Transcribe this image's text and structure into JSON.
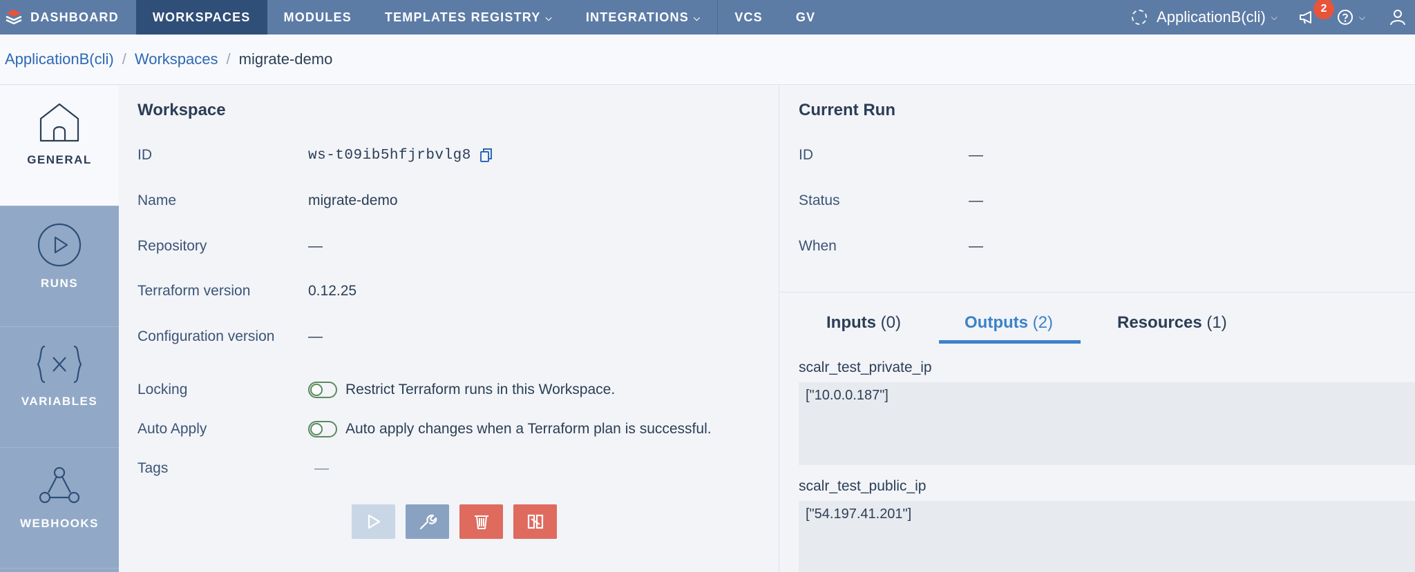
{
  "topnav": {
    "brand": "DASHBOARD",
    "items": [
      {
        "label": "WORKSPACES",
        "active": true,
        "chevron": false
      },
      {
        "label": "MODULES",
        "active": false,
        "chevron": false
      },
      {
        "label": "TEMPLATES REGISTRY",
        "active": false,
        "chevron": true
      },
      {
        "label": "INTEGRATIONS",
        "active": false,
        "chevron": true
      },
      {
        "label": "VCS",
        "active": false,
        "chevron": false
      },
      {
        "label": "GV",
        "active": false,
        "chevron": false
      }
    ],
    "environment": "ApplicationB(cli)",
    "notification_count": "2",
    "chevron_glyph": "⌵"
  },
  "breadcrumb": {
    "items": [
      "ApplicationB(cli)",
      "Workspaces"
    ],
    "separator": "/",
    "current": "migrate-demo"
  },
  "sidebar": {
    "items": [
      {
        "label": "GENERAL",
        "icon": "home-icon",
        "active": true
      },
      {
        "label": "RUNS",
        "icon": "play-circle-icon",
        "active": false
      },
      {
        "label": "VARIABLES",
        "icon": "variables-icon",
        "active": false
      },
      {
        "label": "WEBHOOKS",
        "icon": "webhooks-icon",
        "active": false
      }
    ]
  },
  "workspace": {
    "title": "Workspace",
    "id_label": "ID",
    "id_value": "ws-t09ib5hfjrbvlg8",
    "name_label": "Name",
    "name_value": "migrate-demo",
    "repo_label": "Repository",
    "repo_value": "—",
    "tf_label": "Terraform version",
    "tf_value": "0.12.25",
    "config_label": "Configuration version",
    "config_value": "—",
    "locking_label": "Locking",
    "locking_text": "Restrict Terraform runs in this Workspace.",
    "autoapply_label": "Auto Apply",
    "autoapply_text": "Auto apply changes when a Terraform plan is successful.",
    "tags_label": "Tags",
    "tags_value": "—"
  },
  "current_run": {
    "title": "Current Run",
    "id_label": "ID",
    "id_value": "—",
    "status_label": "Status",
    "status_value": "—",
    "when_label": "When",
    "when_value": "—"
  },
  "tabs": [
    {
      "label": "Inputs",
      "count": "(0)",
      "active": false
    },
    {
      "label": "Outputs",
      "count": "(2)",
      "active": true
    },
    {
      "label": "Resources",
      "count": "(1)",
      "active": false
    }
  ],
  "outputs": [
    {
      "name": "scalr_test_private_ip",
      "value": "[\"10.0.0.187\"]"
    },
    {
      "name": "scalr_test_public_ip",
      "value": "[\"54.197.41.201\"]"
    }
  ],
  "colors": {
    "nav_bg": "#5c7ca6",
    "nav_active": "#2f4e78",
    "sidebar_bg": "#91a9c6",
    "link": "#2e68b5",
    "tab_active": "#3b82c9",
    "danger": "#df6a5e",
    "badge": "#e8543a"
  }
}
